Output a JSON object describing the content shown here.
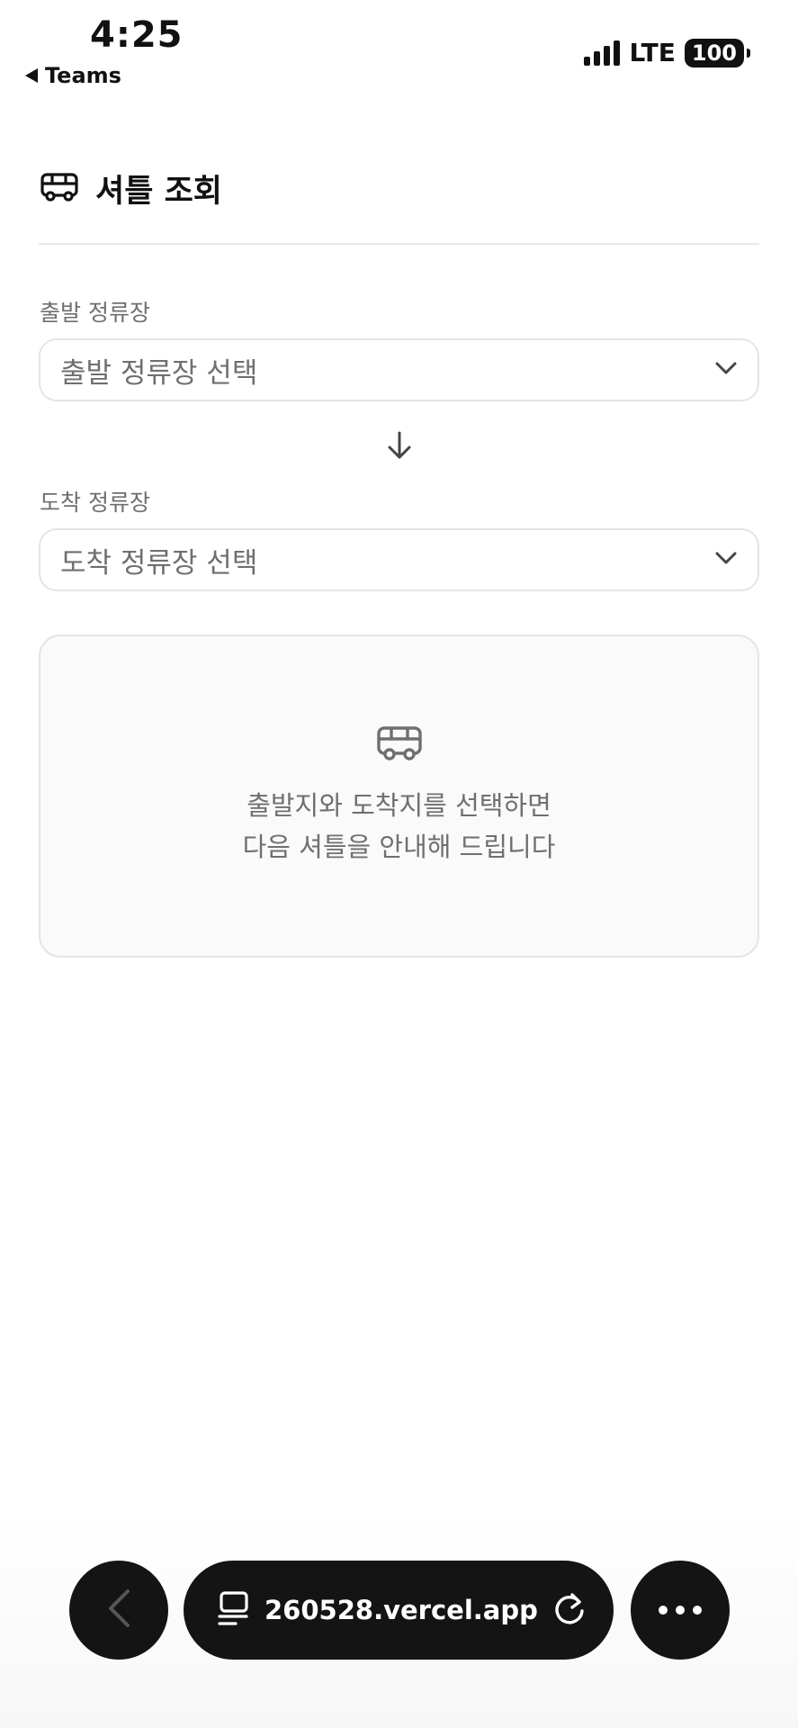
{
  "status_bar": {
    "time": "4:25",
    "back_app": "Teams",
    "network": "LTE",
    "battery": "100"
  },
  "header": {
    "icon": "bus-icon",
    "title": "셔틀 조회"
  },
  "departure": {
    "label": "출발 정류장",
    "placeholder": "출발 정류장 선택"
  },
  "arrival": {
    "label": "도착 정류장",
    "placeholder": "도착 정류장 선택"
  },
  "info_card": {
    "icon": "bus-icon",
    "line1": "출발지와 도착지를 선택하면",
    "line2": "다음 셔틀을 안내해 드립니다"
  },
  "browser_bar": {
    "url": "260528.vercel.app",
    "back_icon": "chevron-left-icon",
    "tabs_icon": "tabs-icon",
    "reload_icon": "reload-icon",
    "more_icon": "more-icon"
  },
  "colors": {
    "background": "#ffffff",
    "muted_text": "#6f6f6f",
    "border": "#e4e4e4",
    "browser_bar": "#141414"
  }
}
